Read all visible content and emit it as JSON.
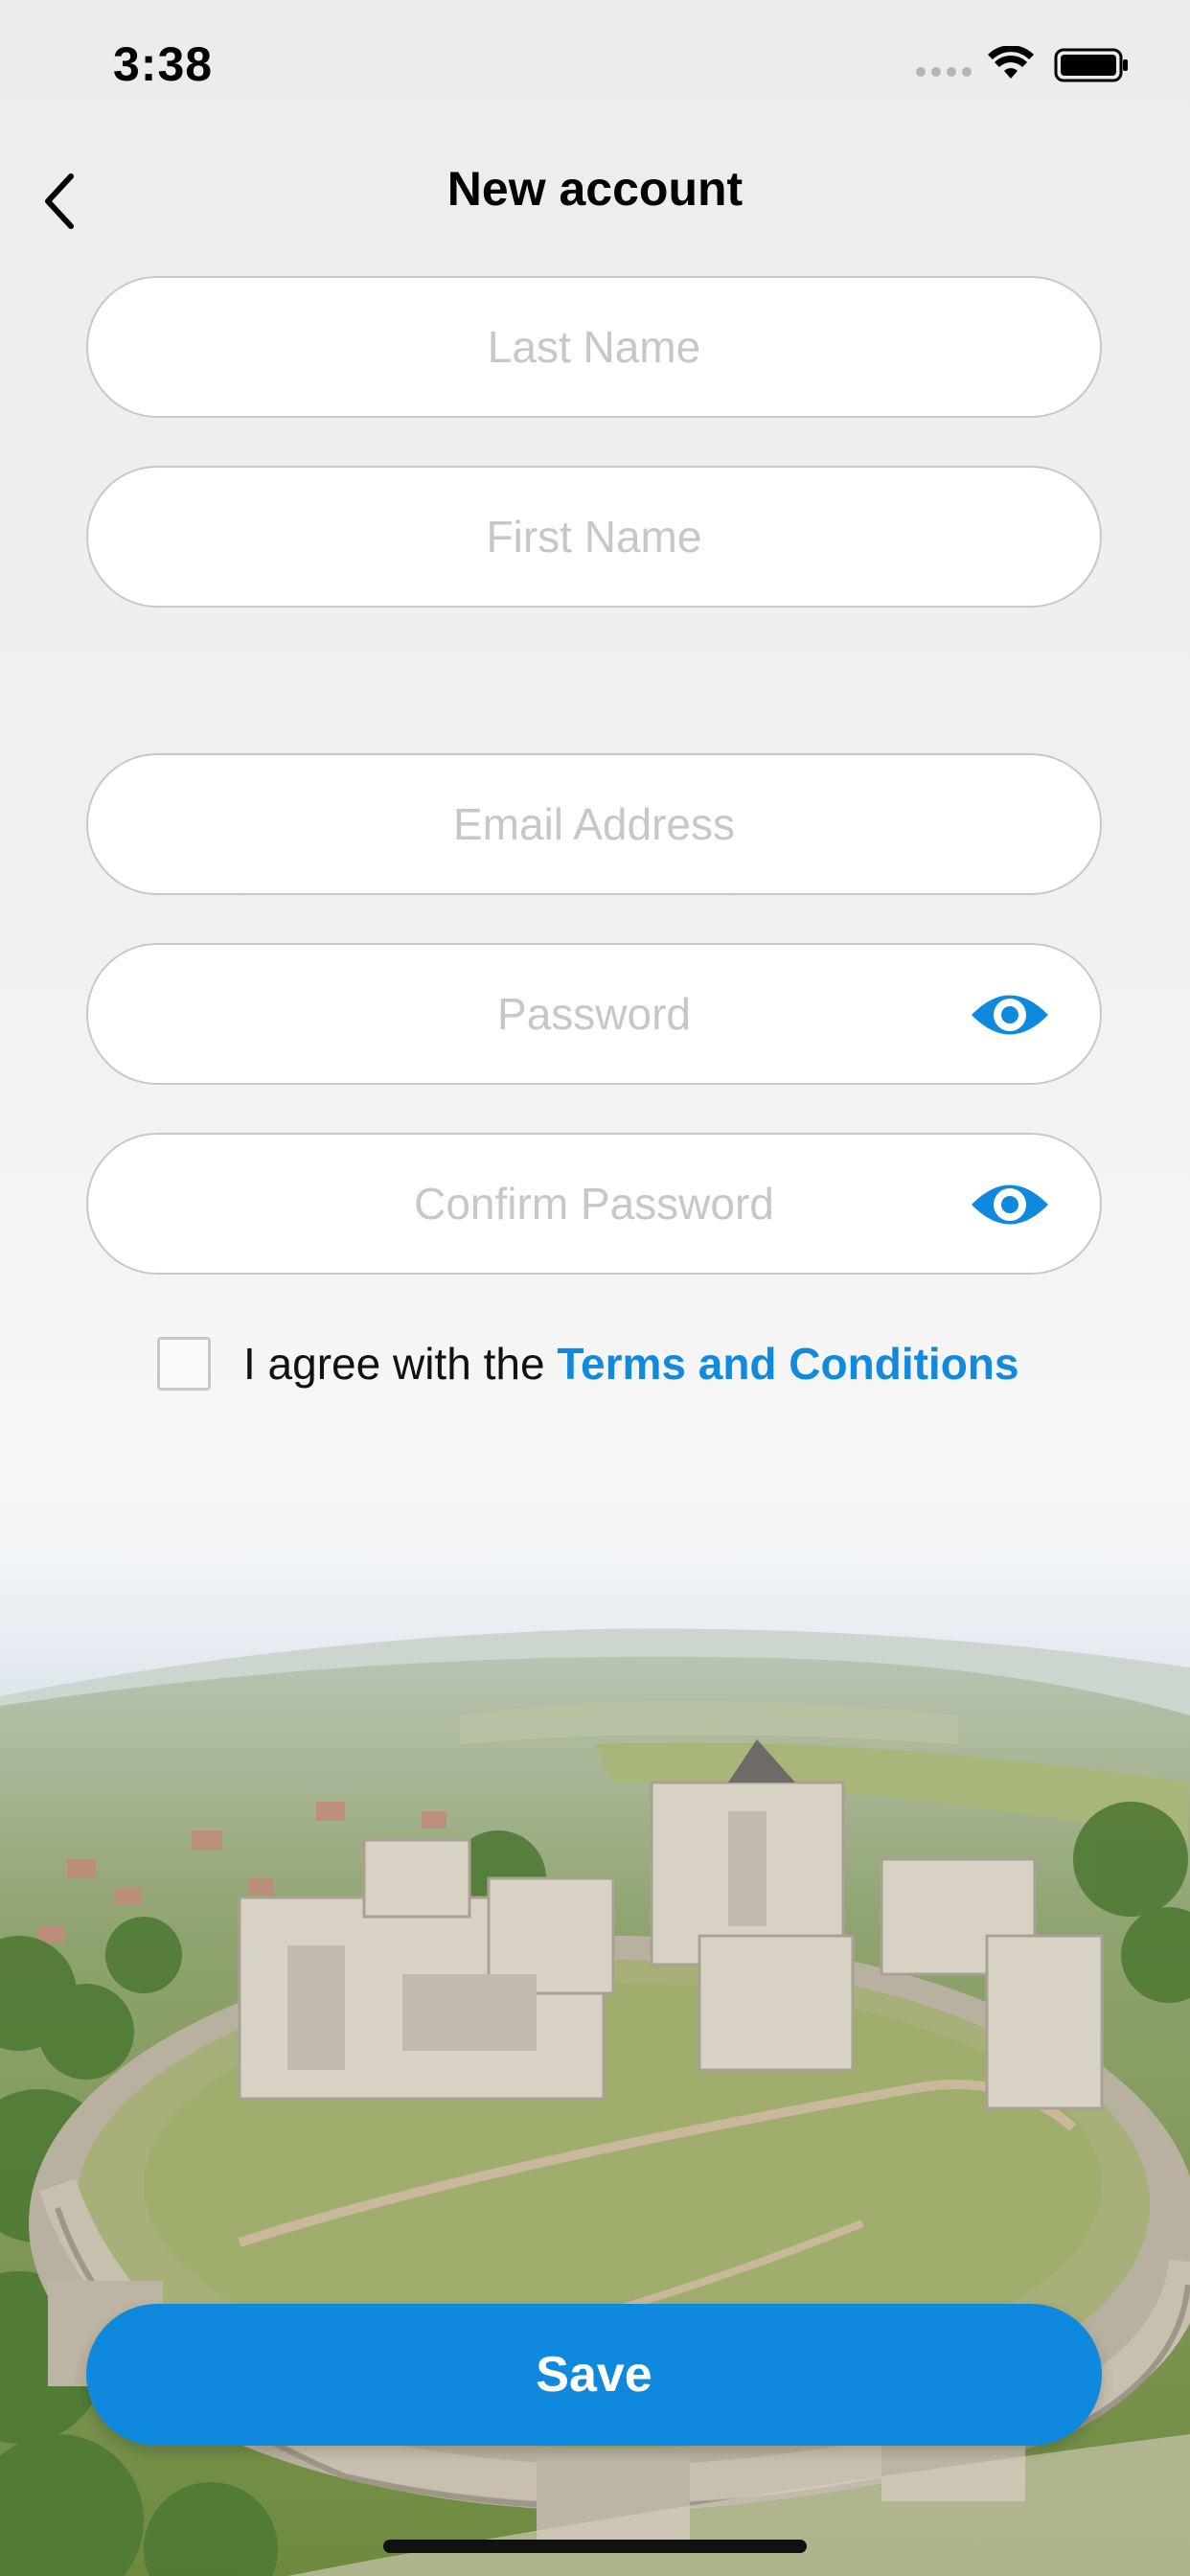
{
  "status_bar": {
    "time": "3:38"
  },
  "nav": {
    "title": "New account",
    "back_icon": "chevron-left-icon"
  },
  "form": {
    "last_name": {
      "placeholder": "Last Name",
      "value": ""
    },
    "first_name": {
      "placeholder": "First Name",
      "value": ""
    },
    "email": {
      "placeholder": "Email Address",
      "value": ""
    },
    "password": {
      "placeholder": "Password",
      "value": "",
      "toggle_icon": "eye-icon"
    },
    "confirm_password": {
      "placeholder": "Confirm Password",
      "value": "",
      "toggle_icon": "eye-icon"
    }
  },
  "terms": {
    "checked": false,
    "prefix": "I agree with the ",
    "link_label": "Terms and Conditions"
  },
  "actions": {
    "save_label": "Save"
  },
  "colors": {
    "accent": "#0e89dd",
    "link": "#1189dd",
    "field_border": "#c8c8c8",
    "placeholder": "#c7c7c7"
  }
}
